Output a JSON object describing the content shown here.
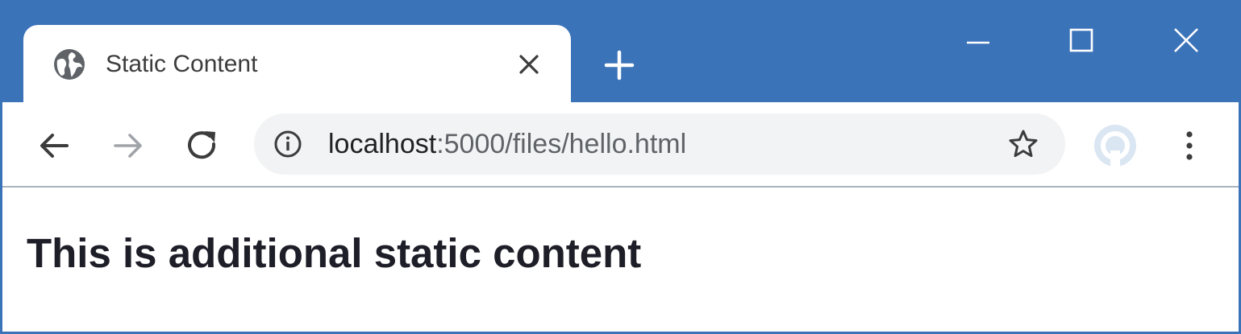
{
  "tab": {
    "title": "Static Content",
    "icon": "globe-icon",
    "close_icon": "close-icon"
  },
  "new_tab": {
    "icon": "plus-icon"
  },
  "window_controls": {
    "minimize_icon": "minimize-icon",
    "maximize_icon": "maximize-icon",
    "close_icon": "close-icon"
  },
  "toolbar": {
    "back_icon": "arrow-left-icon",
    "forward_icon": "arrow-right-icon",
    "reload_icon": "reload-icon",
    "info_icon": "info-icon",
    "bookmark_icon": "star-icon",
    "profile_icon": "avatar-icon",
    "menu_icon": "kebab-menu-icon"
  },
  "address_bar": {
    "host": "localhost",
    "path": ":5000/files/hello.html"
  },
  "page": {
    "heading": "This is additional static content"
  },
  "colors": {
    "titlebar": "#3b73b9",
    "omnibox": "#f1f3f4",
    "text": "#1e1e28"
  }
}
